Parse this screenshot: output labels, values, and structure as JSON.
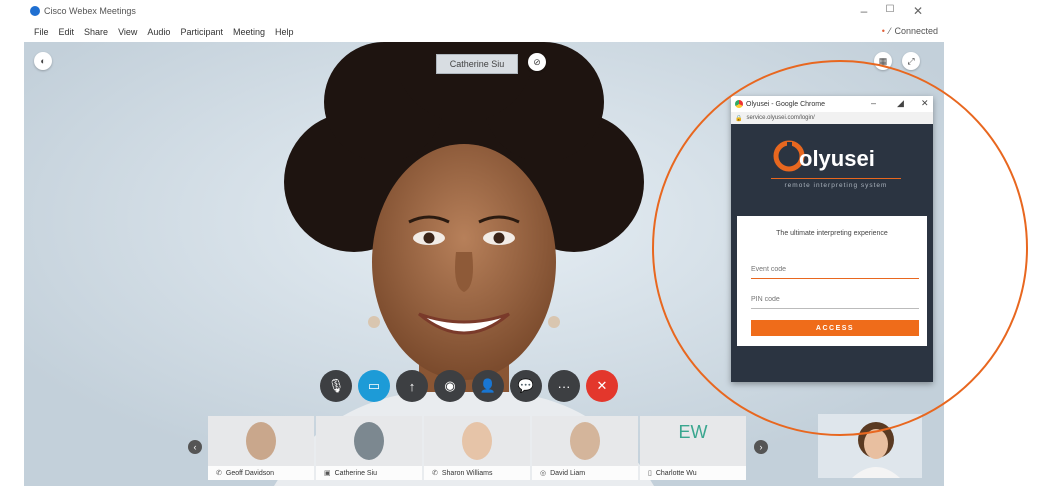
{
  "window": {
    "app_title": "Cisco Webex Meetings",
    "controls": {
      "minimize": "–",
      "maximize": "☐",
      "close": "✕"
    }
  },
  "menu": {
    "items": [
      "File",
      "Edit",
      "Share",
      "View",
      "Audio",
      "Participant",
      "Meeting",
      "Help"
    ],
    "connection_label": "Connected"
  },
  "meeting": {
    "active_speaker": "Catherine Siu",
    "controls": [
      {
        "icon": "microphone-icon",
        "glyph": "🎙"
      },
      {
        "icon": "video-camera-icon",
        "glyph": "▭"
      },
      {
        "icon": "share-icon",
        "glyph": "↑"
      },
      {
        "icon": "record-icon",
        "glyph": "◉"
      },
      {
        "icon": "participants-icon",
        "glyph": "👤"
      },
      {
        "icon": "chat-icon",
        "glyph": "💬"
      },
      {
        "icon": "more-options-icon",
        "glyph": "···"
      },
      {
        "icon": "end-call-icon",
        "glyph": "✕"
      }
    ],
    "participants": [
      {
        "name": "Geoff Davidson",
        "kind": "photo",
        "tone": "#c9a78c"
      },
      {
        "name": "Catherine Siu",
        "kind": "photo",
        "tone": "#7c8890"
      },
      {
        "name": "Sharon Williams",
        "kind": "photo",
        "tone": "#e6c4a8"
      },
      {
        "name": "David Liam",
        "kind": "photo",
        "tone": "#d4b59b"
      },
      {
        "name": "Charlotte Wu",
        "kind": "initials",
        "initials": "EW"
      }
    ]
  },
  "popup": {
    "window_title": "Olyusei - Google Chrome",
    "url": "service.olyusei.com/login/",
    "brand_name": "olyusei",
    "tagline": "remote interpreting system",
    "slogan": "The ultimate interpreting experience",
    "event_code_placeholder": "Event code",
    "pin_placeholder": "PIN code",
    "access_label": "ACCESS"
  },
  "colors": {
    "accent": "#e8671f",
    "webex_blue": "#1d9bd7",
    "end_red": "#e3372c"
  }
}
